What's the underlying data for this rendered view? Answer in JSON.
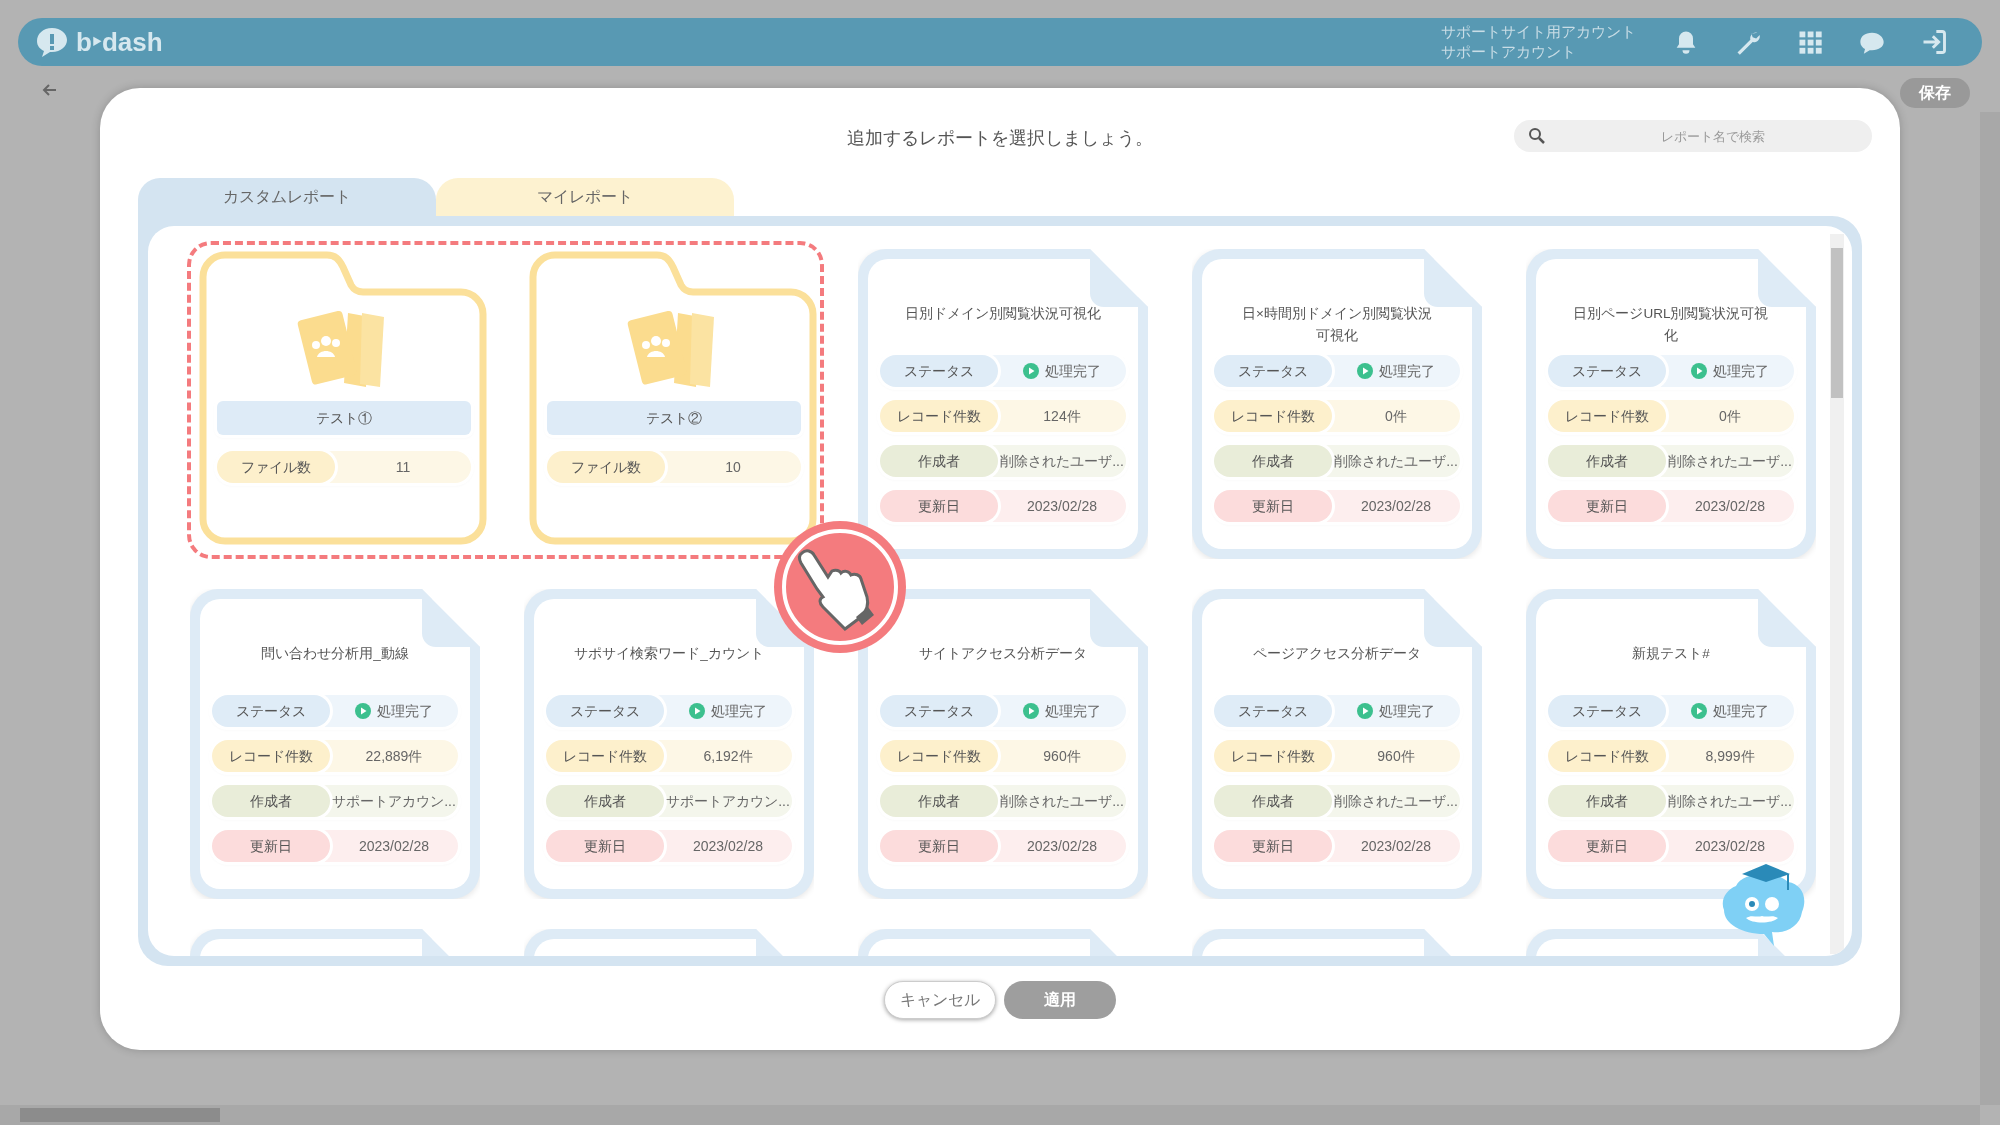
{
  "header": {
    "logo": "b‣dash",
    "account": "サポートサイト用アカウント",
    "user": "サポートアカウント"
  },
  "toolbar": {
    "save_button": "保存"
  },
  "dialog": {
    "title": "追加するレポートを選択しましょう。",
    "search": {
      "placeholder": "レポート名で検索"
    },
    "tabs": [
      {
        "label": "カスタムレポート",
        "selected": true
      },
      {
        "label": "マイレポート",
        "selected": false
      }
    ],
    "folders": [
      {
        "name": "テスト①",
        "count_label": "ファイル数",
        "count": "11"
      },
      {
        "name": "テスト②",
        "count_label": "ファイル数",
        "count": "10"
      }
    ],
    "reports": [
      {
        "title": "日別ドメイン別閲覧状況可視化",
        "fields": [
          {
            "kind": "status",
            "label": "ステータス",
            "value": "処理完了"
          },
          {
            "kind": "records",
            "label": "レコード件数",
            "value": "124件"
          },
          {
            "kind": "author",
            "label": "作成者",
            "value": "削除されたユーザ..."
          },
          {
            "kind": "updated",
            "label": "更新日",
            "value": "2023/02/28"
          }
        ]
      },
      {
        "title": "日×時間別ドメイン別閲覧状況可視化",
        "fields": [
          {
            "kind": "status",
            "label": "ステータス",
            "value": "処理完了"
          },
          {
            "kind": "records",
            "label": "レコード件数",
            "value": "0件"
          },
          {
            "kind": "author",
            "label": "作成者",
            "value": "削除されたユーザ..."
          },
          {
            "kind": "updated",
            "label": "更新日",
            "value": "2023/02/28"
          }
        ]
      },
      {
        "title": "日別ページURL別閲覧状況可視化",
        "fields": [
          {
            "kind": "status",
            "label": "ステータス",
            "value": "処理完了"
          },
          {
            "kind": "records",
            "label": "レコード件数",
            "value": "0件"
          },
          {
            "kind": "author",
            "label": "作成者",
            "value": "削除されたユーザ..."
          },
          {
            "kind": "updated",
            "label": "更新日",
            "value": "2023/02/28"
          }
        ]
      },
      {
        "title": "問い合わせ分析用_動線",
        "fields": [
          {
            "kind": "status",
            "label": "ステータス",
            "value": "処理完了"
          },
          {
            "kind": "records",
            "label": "レコード件数",
            "value": "22,889件"
          },
          {
            "kind": "author",
            "label": "作成者",
            "value": "サポートアカウン..."
          },
          {
            "kind": "updated",
            "label": "更新日",
            "value": "2023/02/28"
          }
        ]
      },
      {
        "title": "サポサイ検索ワード_カウント",
        "fields": [
          {
            "kind": "status",
            "label": "ステータス",
            "value": "処理完了"
          },
          {
            "kind": "records",
            "label": "レコード件数",
            "value": "6,192件"
          },
          {
            "kind": "author",
            "label": "作成者",
            "value": "サポートアカウン..."
          },
          {
            "kind": "updated",
            "label": "更新日",
            "value": "2023/02/28"
          }
        ]
      },
      {
        "title": "サイトアクセス分析データ",
        "fields": [
          {
            "kind": "status",
            "label": "ステータス",
            "value": "処理完了"
          },
          {
            "kind": "records",
            "label": "レコード件数",
            "value": "960件"
          },
          {
            "kind": "author",
            "label": "作成者",
            "value": "削除されたユーザ..."
          },
          {
            "kind": "updated",
            "label": "更新日",
            "value": "2023/02/28"
          }
        ]
      },
      {
        "title": "ページアクセス分析データ",
        "fields": [
          {
            "kind": "status",
            "label": "ステータス",
            "value": "処理完了"
          },
          {
            "kind": "records",
            "label": "レコード件数",
            "value": "960件"
          },
          {
            "kind": "author",
            "label": "作成者",
            "value": "削除されたユーザ..."
          },
          {
            "kind": "updated",
            "label": "更新日",
            "value": "2023/02/28"
          }
        ]
      },
      {
        "title": "新規テスト#",
        "fields": [
          {
            "kind": "status",
            "label": "ステータス",
            "value": "処理完了"
          },
          {
            "kind": "records",
            "label": "レコード件数",
            "value": "8,999件"
          },
          {
            "kind": "author",
            "label": "作成者",
            "value": "削除されたユーザ..."
          },
          {
            "kind": "updated",
            "label": "更新日",
            "value": "2023/02/28"
          }
        ]
      }
    ],
    "buttons": [
      {
        "label": "キャンセル",
        "disabled": false
      },
      {
        "label": "適用",
        "disabled": true
      }
    ]
  }
}
